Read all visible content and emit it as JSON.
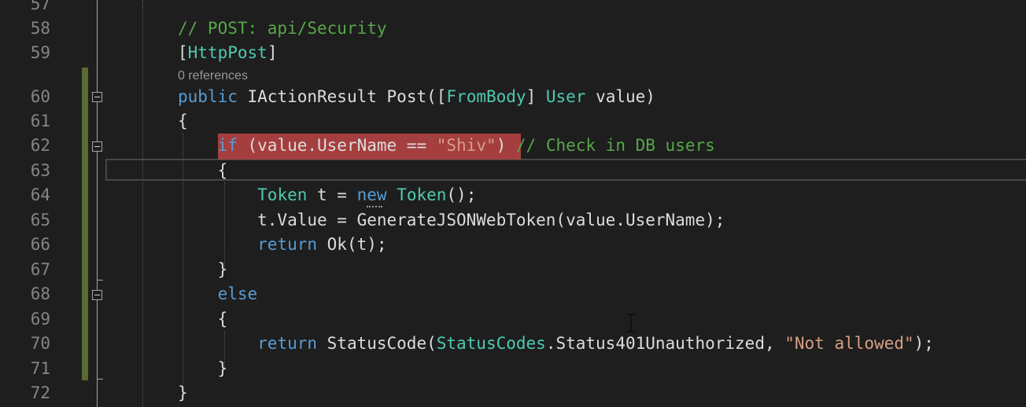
{
  "codelens": "0 references",
  "lines": [
    {
      "num": "57",
      "tokens": []
    },
    {
      "num": "58",
      "tokens": [
        {
          "t": "// POST: api/Security",
          "c": "comment"
        }
      ]
    },
    {
      "num": "59",
      "tokens": [
        {
          "t": "[",
          "c": "plain"
        },
        {
          "t": "HttpPost",
          "c": "attr"
        },
        {
          "t": "]",
          "c": "plain"
        }
      ]
    },
    {
      "num": "60",
      "tokens": [
        {
          "t": "public",
          "c": "kw"
        },
        {
          "t": " ",
          "c": "plain"
        },
        {
          "t": "IActionResult",
          "c": "plain"
        },
        {
          "t": " Post([",
          "c": "plain"
        },
        {
          "t": "FromBody",
          "c": "attr"
        },
        {
          "t": "] ",
          "c": "plain"
        },
        {
          "t": "User",
          "c": "type"
        },
        {
          "t": " value)",
          "c": "plain"
        }
      ]
    },
    {
      "num": "61",
      "tokens": [
        {
          "t": "{",
          "c": "plain"
        }
      ]
    },
    {
      "num": "62",
      "tokens": [
        {
          "t": "    ",
          "c": "plain"
        },
        {
          "t": "if",
          "c": "kw"
        },
        {
          "t": " (value.UserName == ",
          "c": "plain"
        },
        {
          "t": "\"Shiv\"",
          "c": "str"
        },
        {
          "t": ") ",
          "c": "plain"
        },
        {
          "t": "// Check in DB users",
          "c": "comment"
        }
      ]
    },
    {
      "num": "63",
      "tokens": [
        {
          "t": "    {",
          "c": "plain"
        }
      ]
    },
    {
      "num": "64",
      "tokens": [
        {
          "t": "        ",
          "c": "plain"
        },
        {
          "t": "Token",
          "c": "type"
        },
        {
          "t": " t = ",
          "c": "plain"
        },
        {
          "t": "new",
          "c": "kw"
        },
        {
          "t": " ",
          "c": "plain"
        },
        {
          "t": "Token",
          "c": "type"
        },
        {
          "t": "();",
          "c": "plain"
        }
      ]
    },
    {
      "num": "65",
      "tokens": [
        {
          "t": "        t.Value = GenerateJSONWebToken(value.UserName);",
          "c": "plain"
        }
      ]
    },
    {
      "num": "66",
      "tokens": [
        {
          "t": "        ",
          "c": "plain"
        },
        {
          "t": "return",
          "c": "kw"
        },
        {
          "t": " Ok(t);",
          "c": "plain"
        }
      ]
    },
    {
      "num": "67",
      "tokens": [
        {
          "t": "    }",
          "c": "plain"
        }
      ]
    },
    {
      "num": "68",
      "tokens": [
        {
          "t": "    ",
          "c": "plain"
        },
        {
          "t": "else",
          "c": "kw"
        }
      ]
    },
    {
      "num": "69",
      "tokens": [
        {
          "t": "    {",
          "c": "plain"
        }
      ]
    },
    {
      "num": "70",
      "tokens": [
        {
          "t": "        ",
          "c": "plain"
        },
        {
          "t": "return",
          "c": "kw"
        },
        {
          "t": " StatusCode(",
          "c": "plain"
        },
        {
          "t": "StatusCodes",
          "c": "type"
        },
        {
          "t": ".Status401Unauthorized, ",
          "c": "plain"
        },
        {
          "t": "\"Not allowed\"",
          "c": "str"
        },
        {
          "t": ");",
          "c": "plain"
        }
      ]
    },
    {
      "num": "71",
      "tokens": [
        {
          "t": "    }",
          "c": "plain"
        }
      ]
    },
    {
      "num": "72",
      "tokens": [
        {
          "t": "}",
          "c": "plain"
        }
      ]
    }
  ],
  "colors": {
    "background": "#1e1e1e",
    "comment": "#57a64a",
    "keyword": "#569cd6",
    "type": "#4ec9b0",
    "string": "#d69d85",
    "line_number": "#858585",
    "breakpoint_highlight": "#a53f3f",
    "change_marker": "#5a6b2f"
  }
}
